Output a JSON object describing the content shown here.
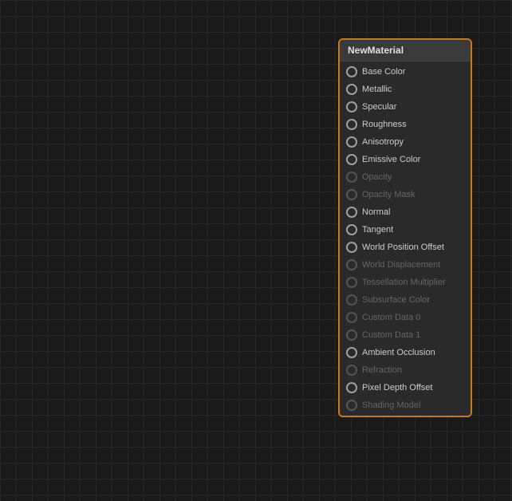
{
  "panel": {
    "title": "NewMaterial",
    "pins": [
      {
        "id": "base-color",
        "label": "Base Color",
        "active": true
      },
      {
        "id": "metallic",
        "label": "Metallic",
        "active": true
      },
      {
        "id": "specular",
        "label": "Specular",
        "active": true
      },
      {
        "id": "roughness",
        "label": "Roughness",
        "active": true
      },
      {
        "id": "anisotropy",
        "label": "Anisotropy",
        "active": true
      },
      {
        "id": "emissive-color",
        "label": "Emissive Color",
        "active": true
      },
      {
        "id": "opacity",
        "label": "Opacity",
        "active": false
      },
      {
        "id": "opacity-mask",
        "label": "Opacity Mask",
        "active": false
      },
      {
        "id": "normal",
        "label": "Normal",
        "active": true
      },
      {
        "id": "tangent",
        "label": "Tangent",
        "active": true
      },
      {
        "id": "world-position-offset",
        "label": "World Position Offset",
        "active": true
      },
      {
        "id": "world-displacement",
        "label": "World Displacement",
        "active": false
      },
      {
        "id": "tessellation-multiplier",
        "label": "Tessellation Multiplier",
        "active": false
      },
      {
        "id": "subsurface-color",
        "label": "Subsurface Color",
        "active": false
      },
      {
        "id": "custom-data-0",
        "label": "Custom Data 0",
        "active": false
      },
      {
        "id": "custom-data-1",
        "label": "Custom Data 1",
        "active": false
      },
      {
        "id": "ambient-occlusion",
        "label": "Ambient Occlusion",
        "active": true
      },
      {
        "id": "refraction",
        "label": "Refraction",
        "active": false
      },
      {
        "id": "pixel-depth-offset",
        "label": "Pixel Depth Offset",
        "active": true
      },
      {
        "id": "shading-model",
        "label": "Shading Model",
        "active": false
      }
    ]
  }
}
